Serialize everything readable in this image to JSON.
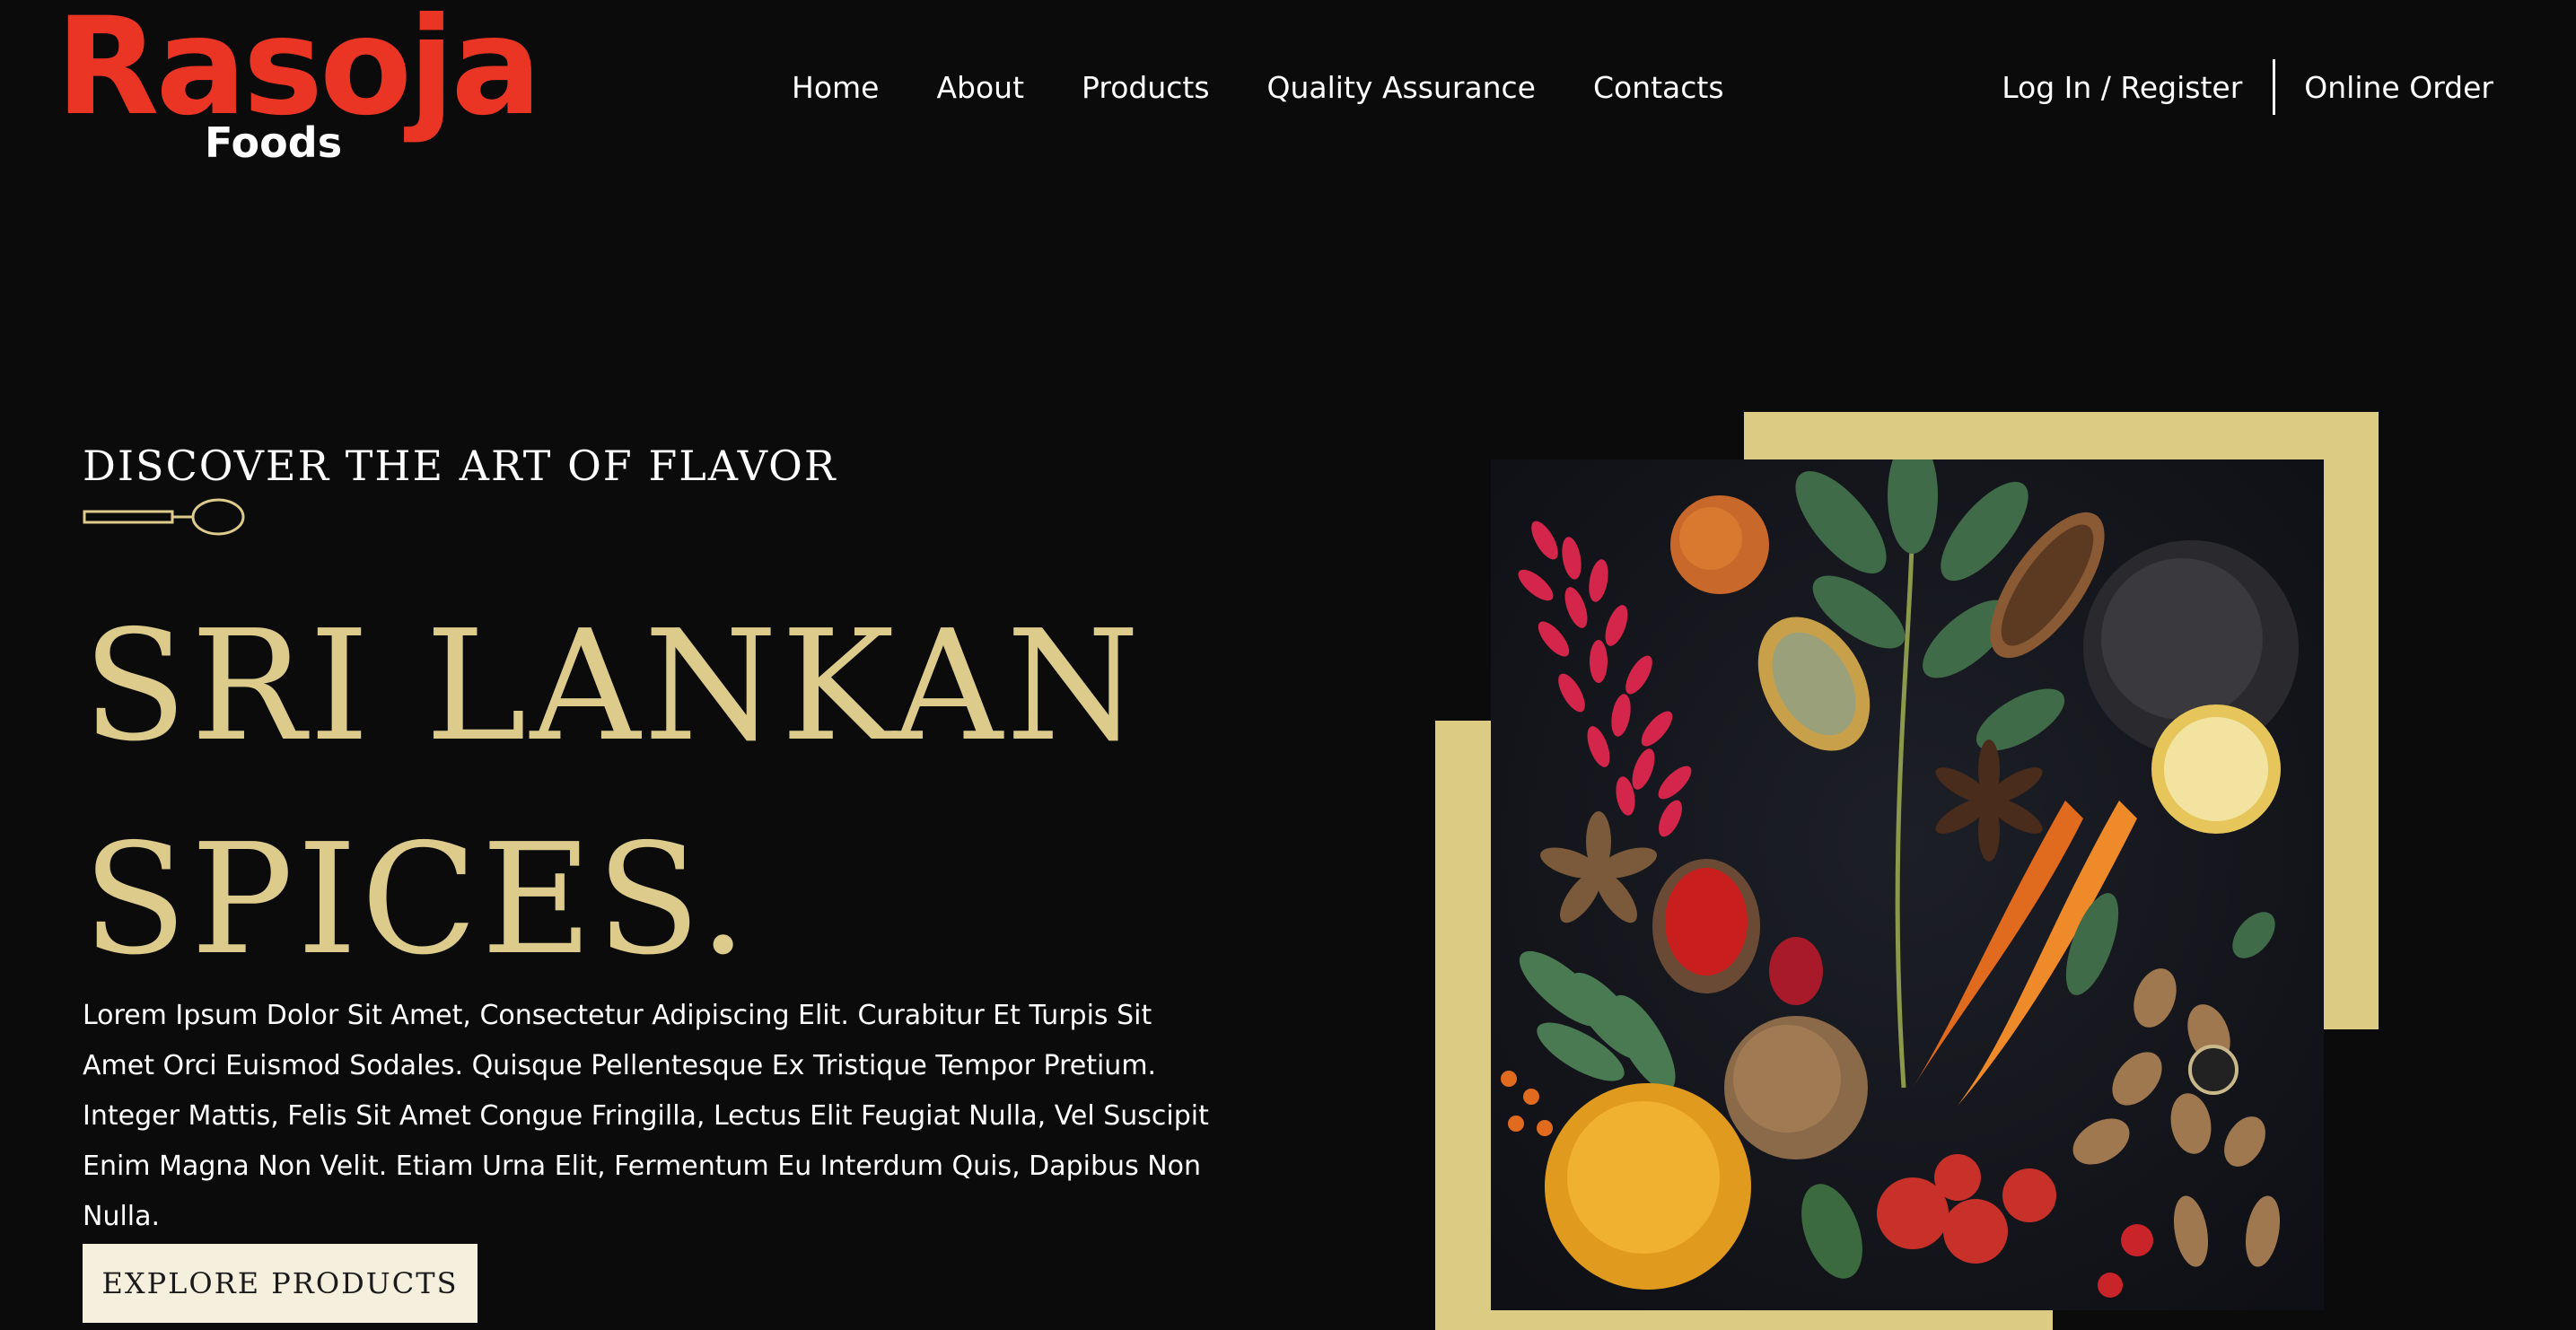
{
  "brand": {
    "name": "Rasoja",
    "tagline": "Foods",
    "logo_color": "#ea3424"
  },
  "nav": {
    "items": [
      {
        "label": "Home"
      },
      {
        "label": "About"
      },
      {
        "label": "Products"
      },
      {
        "label": "Quality Assurance"
      },
      {
        "label": "Contacts"
      }
    ],
    "login_label": "Log In / Register",
    "order_label": "Online Order"
  },
  "hero": {
    "eyebrow": "DISCOVER THE ART OF FLAVOR",
    "title_line1": "SRI LANKAN",
    "title_line2": "SPICES.",
    "description": "Lorem Ipsum Dolor Sit Amet, Consectetur Adipiscing Elit. Curabitur Et Turpis Sit Amet Orci Euismod Sodales. Quisque Pellentesque Ex Tristique Tempor Pretium. Integer Mattis, Felis Sit Amet Congue Fringilla, Lectus Elit Feugiat Nulla, Vel Suscipit Enim Magna Non Velit. Etiam Urna Elit, Fermentum Eu Interdum Quis, Dapibus Non Nulla.",
    "cta_label": "EXPLORE PRODUCTS"
  },
  "icons": {
    "spoon": "spoon-icon",
    "image": "spices-image"
  },
  "colors": {
    "background": "#0b0b0b",
    "accent_gold": "#dccb8b",
    "button_bg": "#f5f0de"
  }
}
